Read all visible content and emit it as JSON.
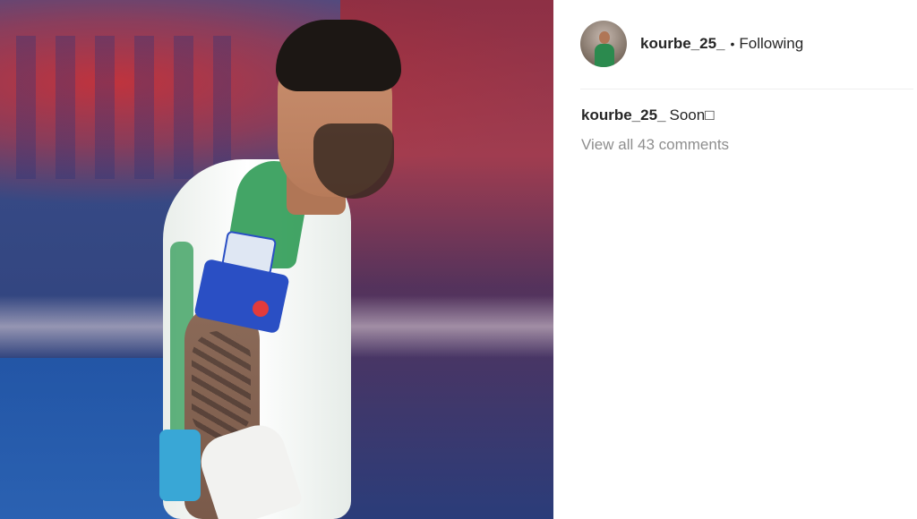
{
  "post": {
    "author": {
      "username": "kourbe_25_",
      "separator": "•",
      "follow_status": "Following"
    },
    "caption": {
      "username": "kourbe_25_",
      "text": "Soon□"
    },
    "comments_link": "View all 43 comments",
    "icons": {
      "avatar": "profile-avatar",
      "photo": "post-photo"
    },
    "colors": {
      "text_primary": "#262626",
      "text_muted": "#8e8e8e",
      "divider": "#efefef"
    }
  }
}
